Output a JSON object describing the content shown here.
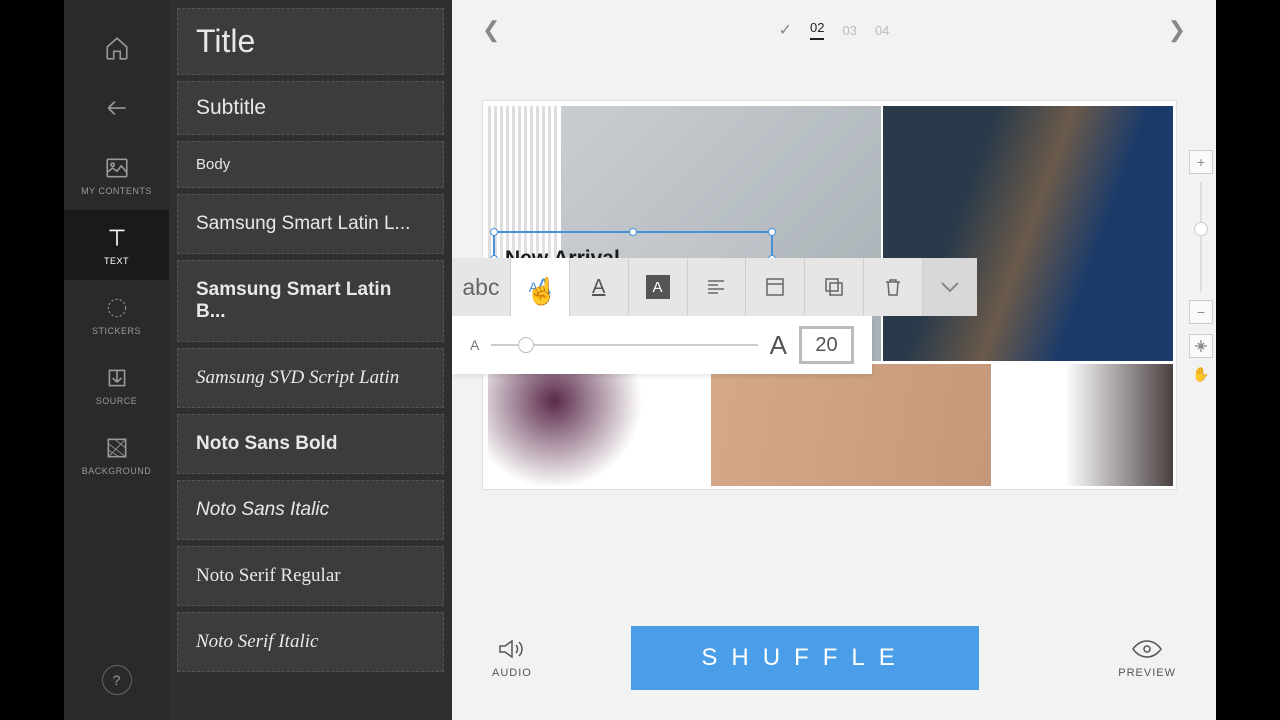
{
  "sidebar": {
    "items": [
      {
        "label": "MY CONTENTS"
      },
      {
        "label": "TEXT"
      },
      {
        "label": "STICKERS"
      },
      {
        "label": "SOURCE"
      },
      {
        "label": "BACKGROUND"
      }
    ]
  },
  "textPanel": {
    "title": "Title",
    "subtitle": "Subtitle",
    "body": "Body",
    "fonts": [
      "Samsung Smart Latin L...",
      "Samsung Smart Latin B...",
      "Samsung SVD Script Latin",
      "Noto Sans Bold",
      "Noto Sans Italic",
      "Noto Serif Regular",
      "Noto Serif Italic"
    ]
  },
  "pager": {
    "pages": [
      "02",
      "03",
      "04"
    ],
    "active": "02"
  },
  "canvas": {
    "selectedText": "New Arrival"
  },
  "toolbar": {
    "abc": "abc",
    "sizeValue": "20",
    "smallA": "A",
    "bigA": "A"
  },
  "bottom": {
    "audio": "AUDIO",
    "shuffle": "SHUFFLE",
    "preview": "PREVIEW"
  },
  "help": "?"
}
